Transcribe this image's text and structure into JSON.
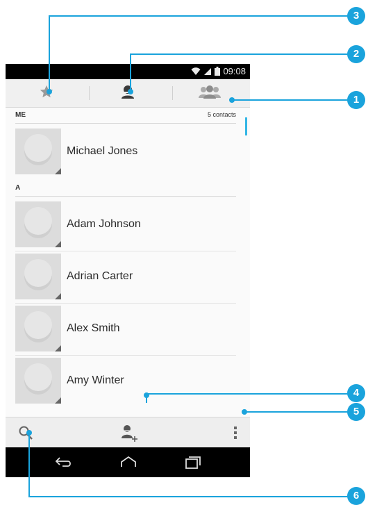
{
  "status": {
    "time": "09:08"
  },
  "tabs": [
    {
      "name": "favorites",
      "icon": "star-icon"
    },
    {
      "name": "contacts",
      "icon": "person-icon"
    },
    {
      "name": "groups",
      "icon": "group-icon"
    }
  ],
  "list": {
    "me_header": "ME",
    "me_count": "5 contacts",
    "me_contact": "Michael Jones",
    "a_header": "A",
    "contacts": [
      "Adam Johnson",
      "Adrian Carter",
      "Alex Smith",
      "Amy Winter"
    ]
  },
  "callouts": [
    "1",
    "2",
    "3",
    "4",
    "5",
    "6"
  ],
  "colors": {
    "accent": "#1aa3dc",
    "tab_highlight": "#33b5e5"
  }
}
